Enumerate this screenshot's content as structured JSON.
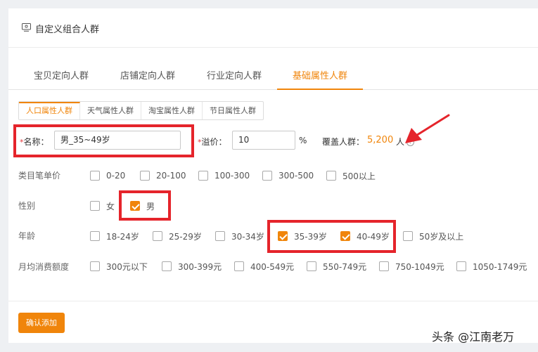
{
  "header": {
    "title": "自定义组合人群",
    "icon": "monitor-icon"
  },
  "tabs": [
    {
      "label": "宝贝定向人群",
      "active": false
    },
    {
      "label": "店铺定向人群",
      "active": false
    },
    {
      "label": "行业定向人群",
      "active": false
    },
    {
      "label": "基础属性人群",
      "active": true
    }
  ],
  "subtabs": [
    {
      "label": "人口属性人群",
      "active": true
    },
    {
      "label": "天气属性人群",
      "active": false
    },
    {
      "label": "淘宝属性人群",
      "active": false
    },
    {
      "label": "节日属性人群",
      "active": false
    }
  ],
  "form": {
    "required_mark": "*",
    "name_label": "名称：",
    "name_value": "男_35~49岁",
    "premium_label": "溢价：",
    "premium_value": "10",
    "premium_unit": "%",
    "coverage_label": "覆盖人群：",
    "coverage_value": "5,200",
    "coverage_unit": "人",
    "help_glyph": "?"
  },
  "rows": {
    "price": {
      "label": "类目笔单价",
      "options": [
        {
          "label": "0-20",
          "checked": false
        },
        {
          "label": "20-100",
          "checked": false
        },
        {
          "label": "100-300",
          "checked": false
        },
        {
          "label": "300-500",
          "checked": false
        },
        {
          "label": "500以上",
          "checked": false
        }
      ]
    },
    "gender": {
      "label": "性别",
      "options": [
        {
          "label": "女",
          "checked": false
        },
        {
          "label": "男",
          "checked": true
        }
      ]
    },
    "age": {
      "label": "年龄",
      "options": [
        {
          "label": "18-24岁",
          "checked": false
        },
        {
          "label": "25-29岁",
          "checked": false
        },
        {
          "label": "30-34岁",
          "checked": false
        },
        {
          "label": "35-39岁",
          "checked": true
        },
        {
          "label": "40-49岁",
          "checked": true
        },
        {
          "label": "50岁及以上",
          "checked": false
        }
      ]
    },
    "spending": {
      "label": "月均消费额度",
      "options": [
        {
          "label": "300元以下",
          "checked": false
        },
        {
          "label": "300-399元",
          "checked": false
        },
        {
          "label": "400-549元",
          "checked": false
        },
        {
          "label": "550-749元",
          "checked": false
        },
        {
          "label": "750-1049元",
          "checked": false
        },
        {
          "label": "1050-1749元",
          "checked": false
        }
      ]
    }
  },
  "confirm_label": "确认添加",
  "watermark": "头条 @江南老万",
  "colors": {
    "accent": "#f0850b",
    "highlight": "#e5242b",
    "required": "#e4393c"
  }
}
